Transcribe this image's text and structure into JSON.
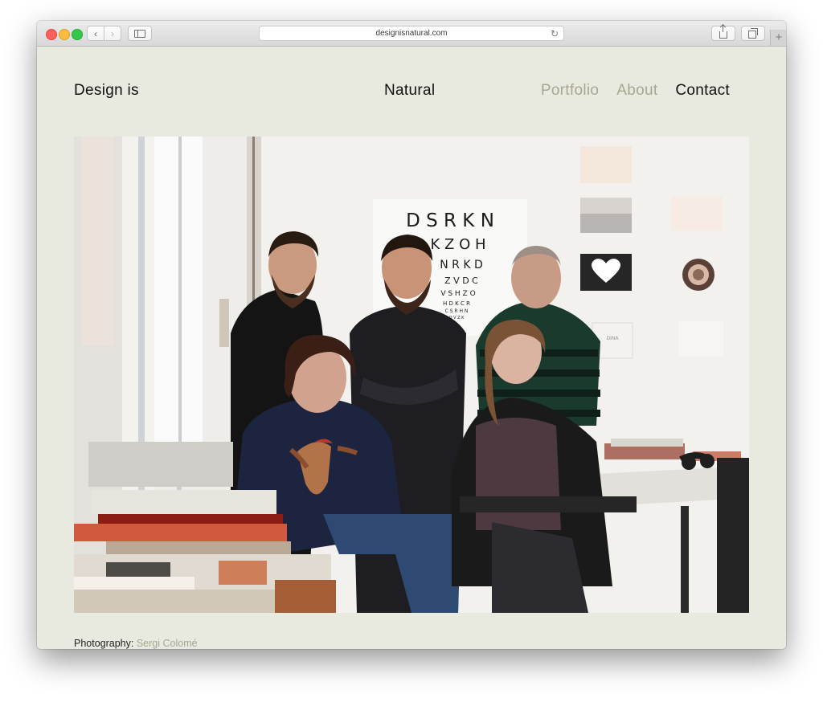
{
  "browser": {
    "url": "designisnatural.com",
    "nav_back_glyph": "‹",
    "nav_forward_glyph": "›",
    "reload_glyph": "↻",
    "new_tab_glyph": "+",
    "icons": [
      "back-icon",
      "forward-icon",
      "sidebar-icon",
      "reload-icon",
      "share-icon",
      "tabs-icon",
      "new-tab-icon"
    ]
  },
  "site": {
    "title": "Design is",
    "title_word": "Natural",
    "nav": [
      {
        "label": "Portfolio",
        "active": false
      },
      {
        "label": "About",
        "active": false
      },
      {
        "label": "Contact",
        "active": true
      }
    ]
  },
  "photo": {
    "eye_chart_rows": [
      "D S R K N",
      "K Z O H",
      "N R K D",
      "Z V D C",
      "V S H Z O",
      "H D K C R",
      "C S R H N",
      "O V Z K"
    ],
    "small_card_text": "DINA"
  },
  "credit": {
    "label": "Photography:",
    "author": "Sergi Colomé"
  },
  "colors": {
    "page_background": "#e9eadf",
    "nav_muted": "#a6a693",
    "nav_active": "#111111"
  }
}
